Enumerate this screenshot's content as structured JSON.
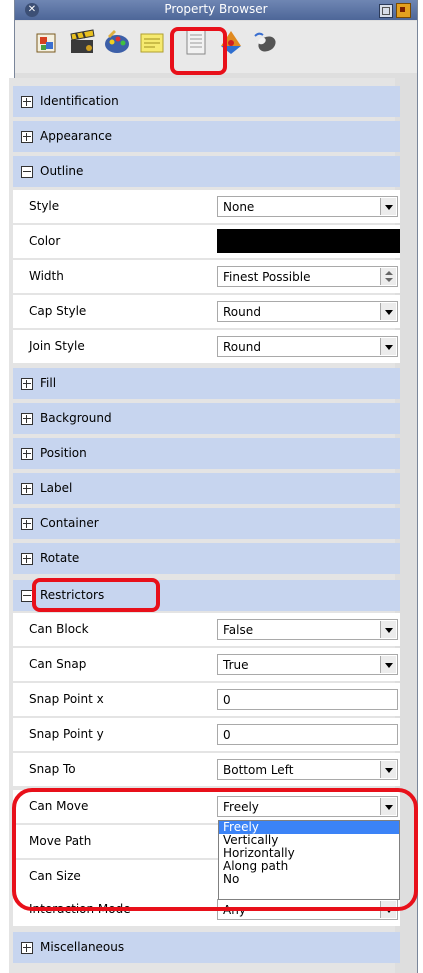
{
  "window": {
    "title": "Property Browser"
  },
  "toolbar": {
    "icons": [
      "document-scene-icon",
      "clapperboard-icon",
      "palette-icon",
      "notes-icon",
      "property-sheet-icon",
      "color-wheel-icon",
      "mouse-icon"
    ],
    "active_index": 4
  },
  "sections": {
    "identification": "Identification",
    "appearance": "Appearance",
    "outline": "Outline",
    "fill": "Fill",
    "background": "Background",
    "position": "Position",
    "label": "Label",
    "container": "Container",
    "rotate": "Rotate",
    "restrictors": "Restrictors",
    "miscellaneous": "Miscellaneous"
  },
  "outline": {
    "style": {
      "label": "Style",
      "value": "None"
    },
    "color": {
      "label": "Color",
      "value": "#000000"
    },
    "width": {
      "label": "Width",
      "value": "Finest Possible"
    },
    "cap_style": {
      "label": "Cap Style",
      "value": "Round"
    },
    "join_style": {
      "label": "Join Style",
      "value": "Round"
    }
  },
  "restrictors": {
    "can_block": {
      "label": "Can Block",
      "value": "False"
    },
    "can_snap": {
      "label": "Can Snap",
      "value": "True"
    },
    "snap_point_x": {
      "label": "Snap Point x",
      "value": "0"
    },
    "snap_point_y": {
      "label": "Snap Point y",
      "value": "0"
    },
    "snap_to": {
      "label": "Snap To",
      "value": "Bottom Left"
    },
    "can_move": {
      "label": "Can Move",
      "value": "Freely"
    },
    "move_path": {
      "label": "Move Path"
    },
    "can_size": {
      "label": "Can Size"
    },
    "interaction_mode": {
      "label": "Interaction Mode",
      "value": "Any"
    }
  },
  "can_move_options": [
    "Freely",
    "Vertically",
    "Horizontally",
    "Along path",
    "No"
  ],
  "colors": {
    "section_bg": "#c7d5ef",
    "highlight": "#e8101a",
    "selected": "#3b83f7"
  }
}
